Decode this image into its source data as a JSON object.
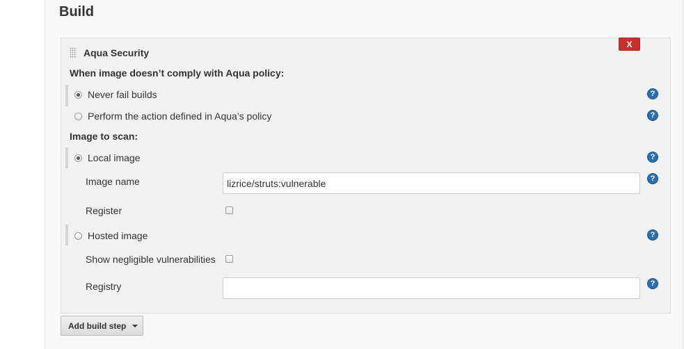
{
  "section": {
    "title": "Build"
  },
  "build_step": {
    "title": "Aqua Security",
    "delete_label": "X",
    "policy_heading": "When image doesn’t comply with Aqua policy:",
    "policy_options": [
      {
        "label": "Never fail builds",
        "selected": true
      },
      {
        "label": "Perform the action defined in Aqua’s policy",
        "selected": false
      }
    ],
    "image_heading": "Image to scan:",
    "local_image": {
      "label": "Local image",
      "selected": true,
      "image_name_label": "Image name",
      "image_name_value": "lizrice/struts:vulnerable",
      "register_label": "Register",
      "register_checked": false
    },
    "hosted_image": {
      "label": "Hosted image",
      "selected": false,
      "negligible_label": "Show negligible vulnerabilities",
      "negligible_checked": false,
      "registry_label": "Registry",
      "registry_value": ""
    },
    "help_glyph": "?"
  },
  "add_build_step": {
    "label": "Add build step",
    "icon": "caret-down-icon"
  }
}
